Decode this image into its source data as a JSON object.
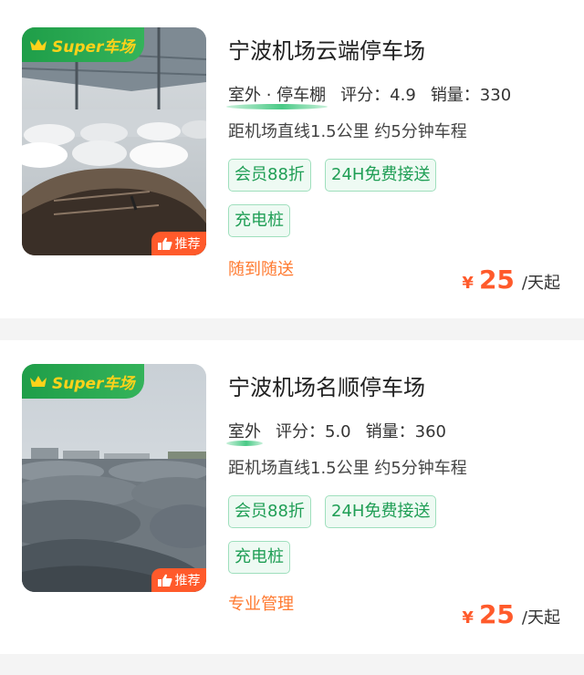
{
  "colors": {
    "brand_green": "#1f9e49",
    "badge_text_yellow": "#ffd21a",
    "accent_orange": "#ff5a2b",
    "tag_green": "#1f9e55",
    "note_orange": "#ff7a30"
  },
  "listings": [
    {
      "badge": "Super车场",
      "recommend": "推荐",
      "title": "宁波机场云端停车场",
      "type": "室外 · 停车棚",
      "rating": "评分：4.9",
      "sales": "销量：330",
      "distance": "距机场直线1.5公里 约5分钟车程",
      "tags": [
        "会员88折",
        "24H免费接送",
        "充电桩"
      ],
      "note": "随到随送",
      "price": {
        "currency": "¥",
        "amount": "25",
        "unit": "/天起"
      }
    },
    {
      "badge": "Super车场",
      "recommend": "推荐",
      "title": "宁波机场名顺停车场",
      "type": "室外",
      "rating": "评分：5.0",
      "sales": "销量：360",
      "distance": "距机场直线1.5公里 约5分钟车程",
      "tags": [
        "会员88折",
        "24H免费接送",
        "充电桩"
      ],
      "note": "专业管理",
      "price": {
        "currency": "¥",
        "amount": "25",
        "unit": "/天起"
      }
    }
  ]
}
